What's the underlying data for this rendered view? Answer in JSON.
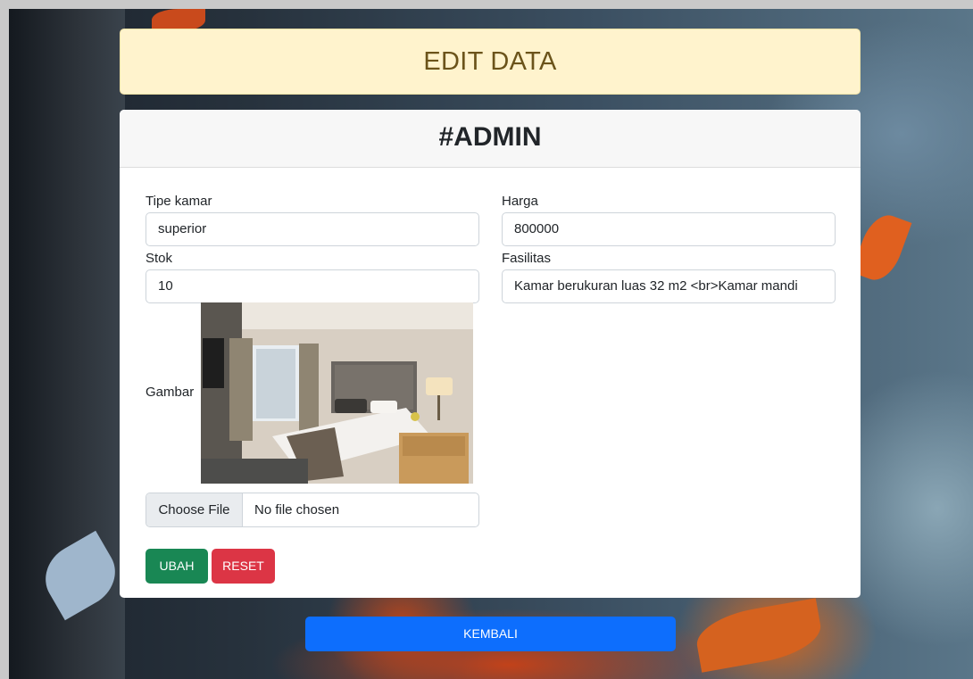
{
  "header": {
    "title": "EDIT DATA"
  },
  "card": {
    "title": "#ADMIN"
  },
  "form": {
    "tipe_kamar": {
      "label": "Tipe kamar",
      "value": "superior"
    },
    "harga": {
      "label": "Harga",
      "value": "800000"
    },
    "stok": {
      "label": "Stok",
      "value": "10"
    },
    "fasilitas": {
      "label": "Fasilitas",
      "value": "Kamar berukuran luas 32 m2 <br>Kamar mandi"
    },
    "gambar": {
      "label": "Gambar"
    },
    "file": {
      "button_label": "Choose File",
      "status": "No file chosen"
    }
  },
  "buttons": {
    "ubah": "UBAH",
    "reset": "RESET",
    "kembali": "KEMBALI"
  },
  "colors": {
    "header_bg": "#fff3cd",
    "ubah": "#198754",
    "reset": "#dc3545",
    "kembali": "#0d6efd"
  }
}
